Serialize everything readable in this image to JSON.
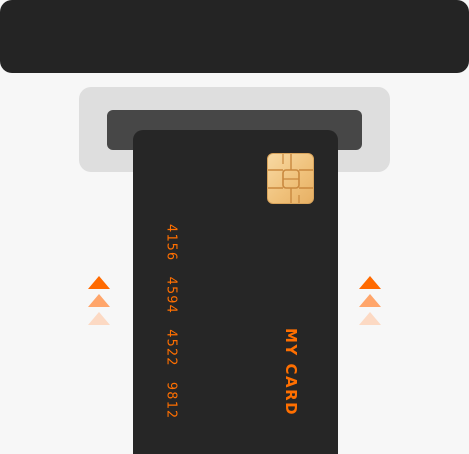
{
  "card": {
    "number": "4156 4594 4522 9812",
    "label": "MY CARD"
  },
  "icons": {
    "chip": "card-chip-icon",
    "arrows": "chevron-up-icon"
  },
  "colors": {
    "accent": "#ff6f00",
    "card_background": "#262626",
    "top_bar": "#242424",
    "slot_outer": "#dedede",
    "slot_inner": "#474747",
    "page_background": "#f7f7f7",
    "chip_gold": "#f0c27c"
  }
}
